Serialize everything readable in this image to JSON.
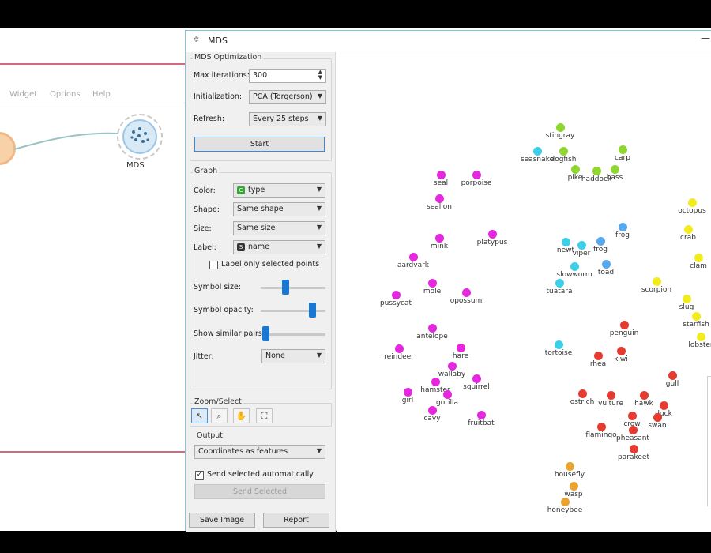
{
  "background": {
    "menu": [
      "Widget",
      "Options",
      "Help"
    ],
    "node_label": "MDS"
  },
  "window": {
    "title": "MDS",
    "minimize_icon": "minimize-icon"
  },
  "optimization": {
    "group_title": "MDS Optimization",
    "max_iterations_label": "Max iterations:",
    "max_iterations_value": "300",
    "initialization_label": "Initialization:",
    "initialization_value": "PCA (Torgerson)",
    "refresh_label": "Refresh:",
    "refresh_value": "Every 25 steps",
    "start_label": "Start"
  },
  "graph": {
    "group_title": "Graph",
    "color_label": "Color:",
    "color_value": "type",
    "shape_label": "Shape:",
    "shape_value": "Same shape",
    "size_label": "Size:",
    "size_value": "Same size",
    "label_label": "Label:",
    "label_value": "name",
    "label_only_selected": "Label only selected points",
    "label_only_selected_checked": false,
    "symbol_size_label": "Symbol size:",
    "symbol_size_level": 0.4,
    "symbol_opacity_label": "Symbol opacity:",
    "symbol_opacity_level": 0.8,
    "show_similar_pairs_label": "Show similar pairs:",
    "show_similar_pairs_level": 0.0,
    "jitter_label": "Jitter:",
    "jitter_value": "None"
  },
  "zoom_select": {
    "group_title": "Zoom/Select",
    "tools": [
      "select-arrow-icon",
      "zoom-icon",
      "pan-hand-icon",
      "reset-zoom-icon"
    ]
  },
  "output": {
    "group_title": "Output",
    "output_value": "Coordinates as features",
    "send_auto_label": "Send selected automatically",
    "send_auto_checked": true,
    "send_selected_label": "Send Selected"
  },
  "footer": {
    "save_image": "Save Image",
    "report": "Report"
  },
  "colors": {
    "fish": "#8fd62f",
    "amphibian_reptile": "#3ecfe8",
    "frog_blue": "#58a8ee",
    "mammal": "#e528e0",
    "bird": "#e63b30",
    "insect": "#e8a330",
    "invertebrate": "#f2ec1e",
    "accent": "#1976d2"
  },
  "points": [
    {
      "label": "stingray",
      "color": "fish"
    },
    {
      "label": "seasnake",
      "color": "amphibian_reptile"
    },
    {
      "label": "dogfish",
      "color": "fish"
    },
    {
      "label": "pike",
      "color": "fish"
    },
    {
      "label": "haddock",
      "color": "fish"
    },
    {
      "label": "carp",
      "color": "fish"
    },
    {
      "label": "bass",
      "color": "fish"
    },
    {
      "label": "seal",
      "color": "mammal"
    },
    {
      "label": "porpoise",
      "color": "mammal"
    },
    {
      "label": "sealion",
      "color": "mammal"
    },
    {
      "label": "mink",
      "color": "mammal"
    },
    {
      "label": "platypus",
      "color": "mammal"
    },
    {
      "label": "aardvark",
      "color": "mammal"
    },
    {
      "label": "mole",
      "color": "mammal"
    },
    {
      "label": "opossum",
      "color": "mammal"
    },
    {
      "label": "pussycat",
      "color": "mammal"
    },
    {
      "label": "antelope",
      "color": "mammal"
    },
    {
      "label": "reindeer",
      "color": "mammal"
    },
    {
      "label": "hare",
      "color": "mammal"
    },
    {
      "label": "wallaby",
      "color": "mammal"
    },
    {
      "label": "hamster",
      "color": "mammal"
    },
    {
      "label": "squirrel",
      "color": "mammal"
    },
    {
      "label": "girl",
      "color": "mammal"
    },
    {
      "label": "gorilla",
      "color": "mammal"
    },
    {
      "label": "cavy",
      "color": "mammal"
    },
    {
      "label": "fruitbat",
      "color": "mammal"
    },
    {
      "label": "frog",
      "color": "frog_blue"
    },
    {
      "label": "newt",
      "color": "amphibian_reptile"
    },
    {
      "label": "viper",
      "color": "amphibian_reptile"
    },
    {
      "label": "frog",
      "color": "frog_blue"
    },
    {
      "label": "slowworm",
      "color": "amphibian_reptile"
    },
    {
      "label": "toad",
      "color": "frog_blue"
    },
    {
      "label": "tuatara",
      "color": "amphibian_reptile"
    },
    {
      "label": "tortoise",
      "color": "amphibian_reptile"
    },
    {
      "label": "scorpion",
      "color": "invertebrate"
    },
    {
      "label": "octopus",
      "color": "invertebrate"
    },
    {
      "label": "crab",
      "color": "invertebrate"
    },
    {
      "label": "clam",
      "color": "invertebrate"
    },
    {
      "label": "slug",
      "color": "invertebrate"
    },
    {
      "label": "starfish",
      "color": "invertebrate"
    },
    {
      "label": "lobster",
      "color": "invertebrate"
    },
    {
      "label": "penguin",
      "color": "bird"
    },
    {
      "label": "kiwi",
      "color": "bird"
    },
    {
      "label": "rhea",
      "color": "bird"
    },
    {
      "label": "ostrich",
      "color": "bird"
    },
    {
      "label": "vulture",
      "color": "bird"
    },
    {
      "label": "hawk",
      "color": "bird"
    },
    {
      "label": "crow",
      "color": "bird"
    },
    {
      "label": "duck",
      "color": "bird"
    },
    {
      "label": "swan",
      "color": "bird"
    },
    {
      "label": "gull",
      "color": "bird"
    },
    {
      "label": "flamingo",
      "color": "bird"
    },
    {
      "label": "pheasant",
      "color": "bird"
    },
    {
      "label": "parakeet",
      "color": "bird"
    },
    {
      "label": "housefly",
      "color": "insect"
    },
    {
      "label": "wasp",
      "color": "insect"
    },
    {
      "label": "honeybee",
      "color": "insect"
    }
  ]
}
